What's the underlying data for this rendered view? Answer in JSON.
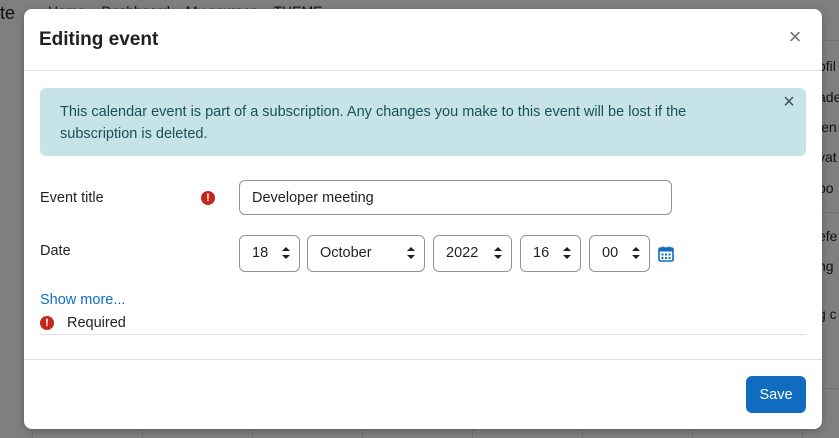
{
  "background": {
    "left_fragment": "te",
    "nav": [
      "Home",
      "Dashboard",
      "My courses",
      "THEME"
    ],
    "right_fragments": [
      "ofil",
      "ade",
      "len",
      "vat",
      "po",
      "efe",
      "ng",
      "g c"
    ]
  },
  "modal": {
    "title": "Editing event",
    "close_label": "×",
    "alert": {
      "text": "This calendar event is part of a subscription. Any changes you make to this event will be lost if the subscription is deleted.",
      "close_label": "×"
    },
    "fields": {
      "event_title_label": "Event title",
      "event_title_value": "Developer meeting",
      "date_label": "Date",
      "day": "18",
      "month": "October",
      "year": "2022",
      "hour": "16",
      "minute": "00"
    },
    "show_more": "Show more...",
    "required_label": "Required",
    "save_label": "Save"
  },
  "colors": {
    "primary": "#0f6cbf",
    "alert_bg": "#c6e4e8",
    "alert_text": "#1b4f58",
    "required_icon": "#c4271b"
  },
  "icons": {
    "required": "exclamation-circle-icon",
    "calendar": "calendar-icon",
    "close": "close-icon"
  }
}
